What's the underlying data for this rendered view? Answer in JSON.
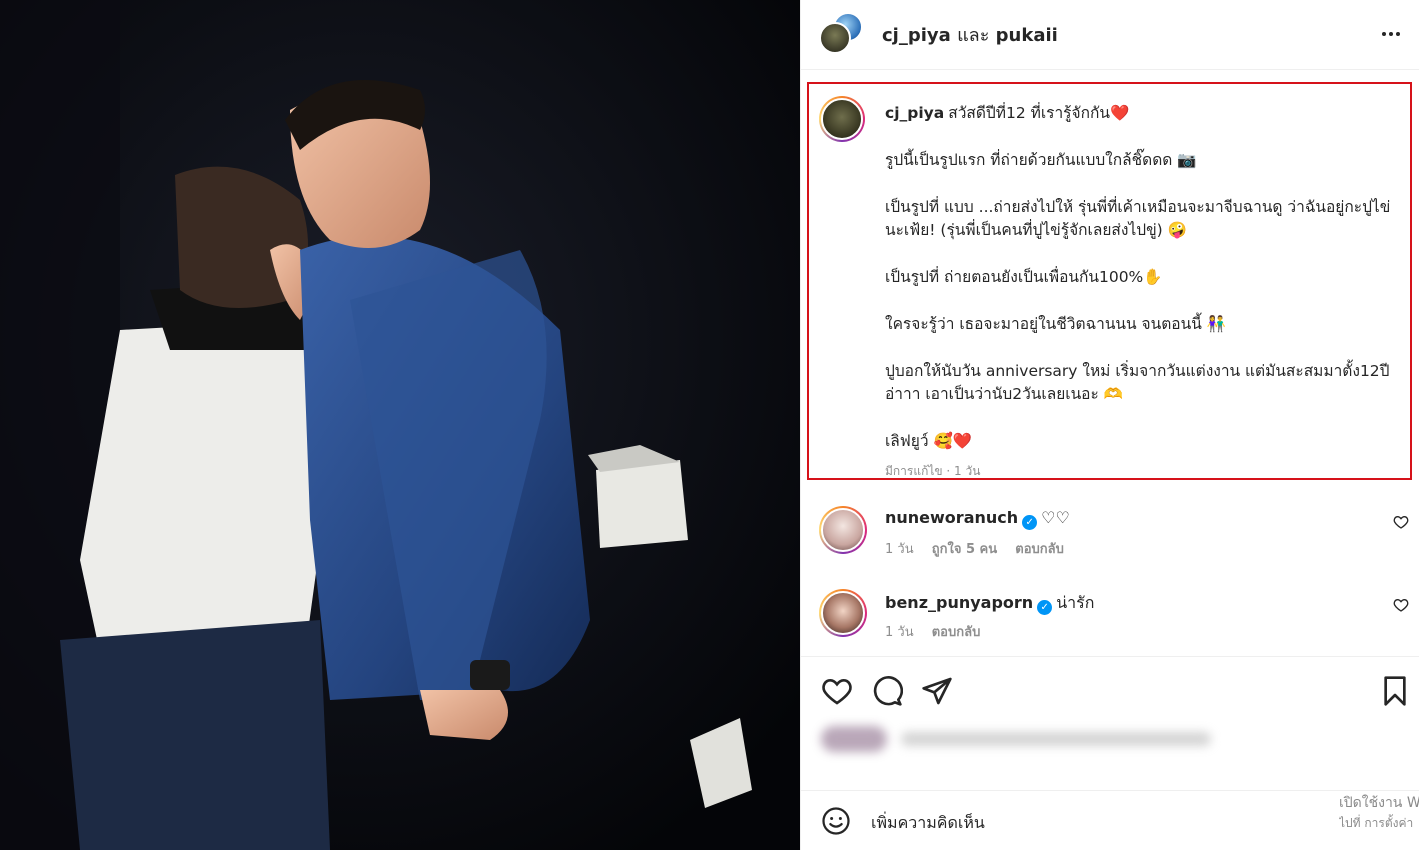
{
  "post": {
    "header": {
      "user1": "cj_piya",
      "separator": "และ",
      "user2": "pukaii"
    },
    "caption": {
      "username": "cj_piya",
      "lines": [
        "สวัสดีปีที่12 ที่เรารู้จักกัน❤️",
        "รูปนี้เป็นรูปแรก ที่ถ่ายด้วยกันแบบใกล้ชิ๊ดดด 📷",
        "เป็นรูปที่ แบบ ...ถ่ายส่งไปให้ รุ่นพี่ที่เค้าเหมือนจะมาจีบฉานดู ว่าฉันอยู่กะปูไข่นะเฟ้ย! (รุ่นพี่เป็นคนที่ปูไข่รู้จักเลยส่งไปขู่) 🤪",
        "เป็นรูปที่ ถ่ายตอนยังเป็นเพื่อนกัน100%✋",
        "ใครจะรู้ว่า เธอจะมาอยู่ในชีวิตฉานนน จนตอนนี้ 👫",
        "ปูบอกให้นับวัน anniversary ใหม่ เริ่มจากวันแต่งงาน แต่มันสะสมมาตั้ง12ปี อ่าาา เอาเป็นว่านับ2วันเลยเนอะ 🫶",
        "เลิฟยูว์ 🥰❤️"
      ],
      "meta": "มีการแก้ไข · 1 วัน"
    },
    "comments": [
      {
        "username": "nuneworanuch",
        "text": "♡♡",
        "time": "1 วัน",
        "likes": "ถูกใจ 5 คน",
        "reply": "ตอบกลับ"
      },
      {
        "username": "benz_punyaporn",
        "text": "น่ารัก",
        "time": "1 วัน",
        "reply": "ตอบกลับ"
      }
    ],
    "actions": [
      "like-icon",
      "comment-icon",
      "share-icon",
      "save-icon"
    ],
    "input": {
      "placeholder": "เพิ่มความคิดเห็น"
    },
    "watermark": {
      "line1": "เปิดใช้งาน Windows",
      "line2": "ไปที่ การตั้งค่า"
    }
  },
  "colors": {
    "highlight_border": "#d6121a",
    "verified": "#0095f6",
    "text_primary": "#262626",
    "text_secondary": "#8e8e8e"
  }
}
